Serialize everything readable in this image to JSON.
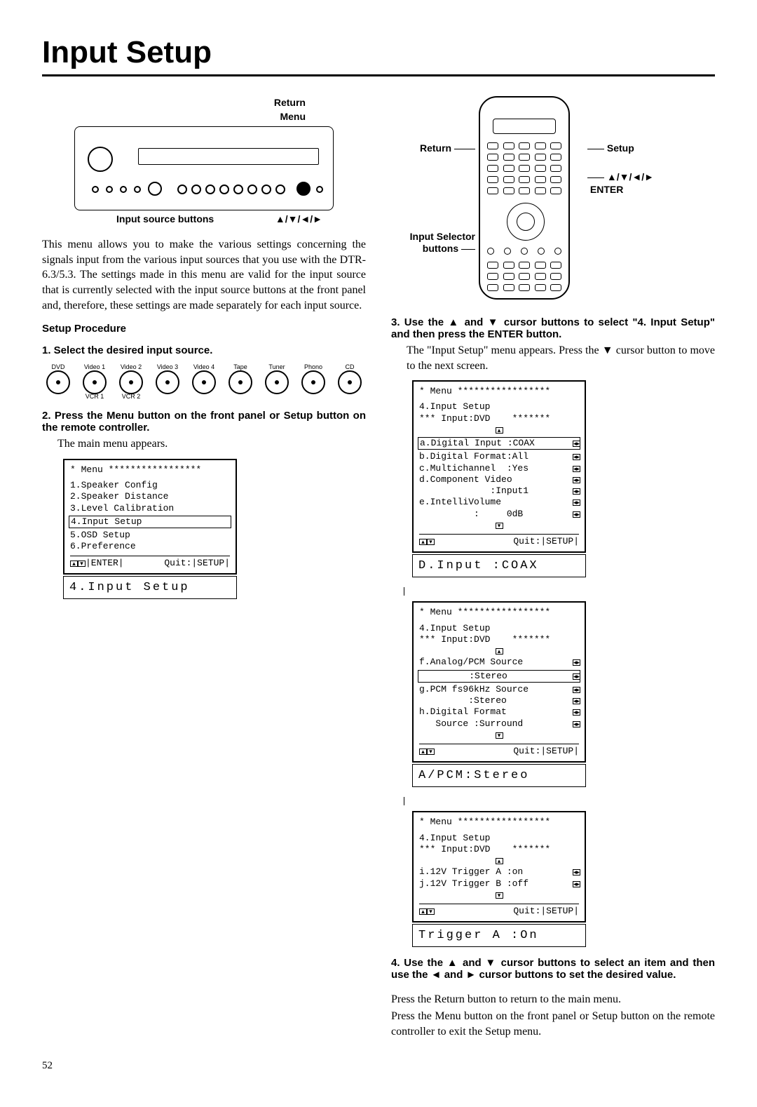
{
  "page_title": "Input Setup",
  "page_number": "52",
  "front_panel": {
    "label_return": "Return",
    "label_menu": "Menu",
    "label_arrows": "▲/▼/◄/►",
    "label_input_source_buttons": "Input source buttons"
  },
  "remote": {
    "label_return": "Return",
    "label_input_selector": "Input Selector buttons",
    "label_setup": "Setup",
    "label_arrows": "▲/▼/◄/►",
    "label_enter": "ENTER"
  },
  "intro_para": "This menu allows you to make the various settings concerning the signals input from the various input sources that you use with the DTR-6.3/5.3. The settings made in this menu are valid for the input source that is currently selected with the input source buttons at the front panel and, therefore, these settings are made separately for each input source.",
  "setup_procedure_heading": "Setup Procedure",
  "step1": "1.  Select the desired input source.",
  "input_sources_top": [
    "DVD",
    "Video 1",
    "Video 2",
    "Video 3",
    "Video 4",
    "Tape",
    "Tuner",
    "Phono",
    "CD"
  ],
  "input_sources_bottom": [
    "",
    "VCR 1",
    "VCR 2",
    "",
    "",
    "",
    "",
    "",
    ""
  ],
  "step2": "2.  Press the Menu button on the front panel or Setup button on the remote controller.",
  "step2_desc": "The main menu appears.",
  "osd_main": {
    "header": "* Menu *****************",
    "items": [
      "1.Speaker Config",
      "2.Speaker Distance",
      "3.Level Calibration",
      "4.Input Setup",
      "5.OSD Setup",
      "6.Preference"
    ],
    "highlight_index": 3,
    "footer_left": "▲▼",
    "footer_mid": "ENTER",
    "footer_right": "Quit:|SETUP|"
  },
  "lcd_main": "4.Input Setup",
  "step3": "3.  Use the ▲ and ▼ cursor buttons to select \"4. Input Setup\" and then press the ENTER button.",
  "step3_desc": "The \"Input Setup\" menu appears. Press the ▼ cursor button to move to the next screen.",
  "osd_a": {
    "header": "* Menu *****************",
    "title1": "4.Input Setup",
    "title2": "*** Input:DVD    *******",
    "lines": [
      "a.Digital Input :COAX",
      "b.Digital Format:All",
      "c.Multichannel  :Yes",
      "d.Component Video",
      "             :Input1",
      "e.IntelliVolume",
      "          :     0dB"
    ],
    "highlight_index": 0,
    "footer_right": "Quit:|SETUP|"
  },
  "lcd_a": "D.Input   :COAX",
  "osd_b": {
    "header": "* Menu *****************",
    "title1": "4.Input Setup",
    "title2": "*** Input:DVD    *******",
    "lines": [
      "f.Analog/PCM Source",
      "         :Stereo",
      "g.PCM fs96kHz Source",
      "         :Stereo",
      "h.Digital Format",
      "   Source :Surround"
    ],
    "highlight_index": 1,
    "footer_right": "Quit:|SETUP|"
  },
  "lcd_b": "A/PCM:Stereo",
  "osd_c": {
    "header": "* Menu *****************",
    "title1": "4.Input Setup",
    "title2": "*** Input:DVD    *******",
    "lines": [
      "i.12V Trigger A :on",
      "j.12V Trigger B :off"
    ],
    "footer_right": "Quit:|SETUP|"
  },
  "lcd_c": "Trigger A   :On",
  "step4": "4.  Use the ▲ and ▼ cursor buttons to select an item and then use the ◄ and ► cursor buttons to set the desired value.",
  "closing1": "Press the Return button to return to the main menu.",
  "closing2": "Press the Menu button on the front panel or Setup button on the remote controller to exit the Setup menu."
}
